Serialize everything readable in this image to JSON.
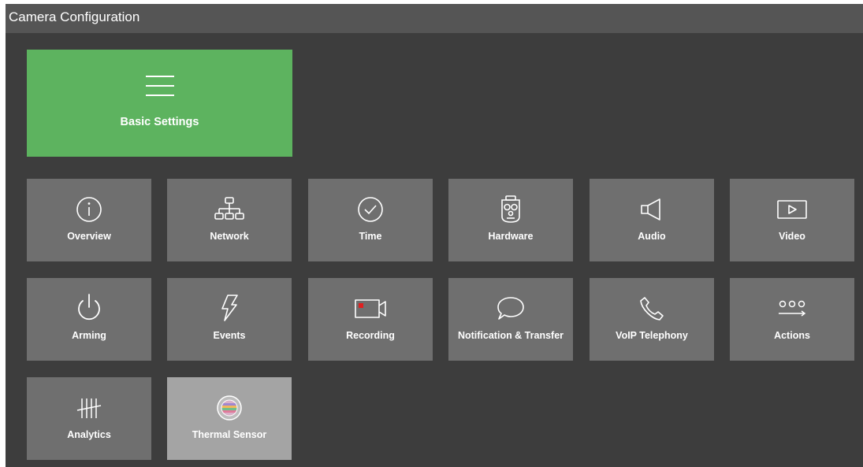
{
  "window": {
    "title": "Camera Configuration"
  },
  "colors": {
    "background": "#3d3d3d",
    "titlebar": "#555555",
    "tile": "#6f6f6f",
    "accent_green": "#5db35f",
    "selected_tile": "#a4a4a4",
    "recording_dot": "#e02020"
  },
  "featured": {
    "label": "Basic Settings",
    "icon": "hamburger-menu-icon"
  },
  "tiles": [
    {
      "label": "Overview",
      "icon": "info-icon"
    },
    {
      "label": "Network",
      "icon": "network-icon"
    },
    {
      "label": "Time",
      "icon": "clock-icon"
    },
    {
      "label": "Hardware",
      "icon": "camera-hardware-icon"
    },
    {
      "label": "Audio",
      "icon": "speaker-icon"
    },
    {
      "label": "Video",
      "icon": "play-icon"
    },
    {
      "label": "Arming",
      "icon": "power-icon"
    },
    {
      "label": "Events",
      "icon": "lightning-icon"
    },
    {
      "label": "Recording",
      "icon": "record-camera-icon"
    },
    {
      "label": "Notification & Transfer",
      "icon": "speech-bubble-icon"
    },
    {
      "label": "VoIP Telephony",
      "icon": "phone-icon"
    },
    {
      "label": "Actions",
      "icon": "actions-icon"
    },
    {
      "label": "Analytics",
      "icon": "tally-icon"
    },
    {
      "label": "Thermal Sensor",
      "icon": "thermal-sensor-icon",
      "selected": true
    }
  ]
}
